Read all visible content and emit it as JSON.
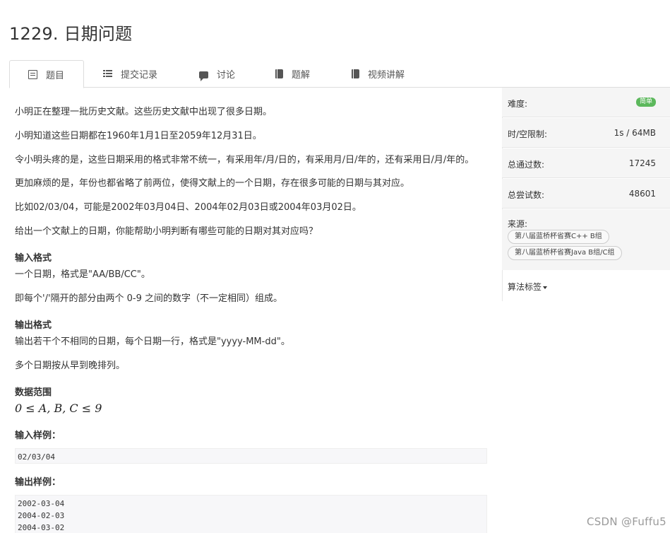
{
  "title": "1229. 日期问题",
  "tabs": [
    {
      "label": "题目",
      "icon": "document-icon"
    },
    {
      "label": "提交记录",
      "icon": "list-icon"
    },
    {
      "label": "讨论",
      "icon": "comment-icon"
    },
    {
      "label": "题解",
      "icon": "book-icon"
    },
    {
      "label": "视频讲解",
      "icon": "book-icon"
    }
  ],
  "problem": {
    "paragraphs": [
      "小明正在整理一批历史文献。这些历史文献中出现了很多日期。",
      "小明知道这些日期都在1960年1月1日至2059年12月31日。",
      "令小明头疼的是，这些日期采用的格式非常不统一，有采用年/月/日的，有采用月/日/年的，还有采用日/月/年的。",
      "更加麻烦的是，年份也都省略了前两位，使得文献上的一个日期，存在很多可能的日期与其对应。",
      "比如02/03/04，可能是2002年03月04日、2004年02月03日或2004年03月02日。",
      "给出一个文献上的日期，你能帮助小明判断有哪些可能的日期对其对应吗？"
    ],
    "input_heading": "输入格式",
    "input_lines": [
      "一个日期，格式是\"AA/BB/CC\"。",
      "即每个'/'隔开的部分由两个 0-9 之间的数字（不一定相同）组成。"
    ],
    "output_heading": "输出格式",
    "output_lines": [
      "输出若干个不相同的日期，每个日期一行，格式是\"yyyy-MM-dd\"。",
      "多个日期按从早到晚排列。"
    ],
    "range_heading": "数据范围",
    "range_formula": "0 ≤ A, B, C ≤ 9",
    "sample_input_heading": "输入样例：",
    "sample_input": "02/03/04",
    "sample_output_heading": "输出样例：",
    "sample_output": "2002-03-04\n2004-02-03\n2004-03-02"
  },
  "sidebar": {
    "difficulty_label": "难度:",
    "difficulty_value": "简单",
    "limit_label": "时/空限制:",
    "limit_value": "1s / 64MB",
    "passed_label": "总通过数:",
    "passed_value": "17245",
    "attempts_label": "总尝试数:",
    "attempts_value": "48601",
    "source_label": "来源:",
    "source_tags": [
      "第八届蓝桥杯省赛C++ B组",
      "第八届蓝桥杯省赛Java B组/C组"
    ],
    "algo_label": "算法标签"
  },
  "watermark": "CSDN @Fuffu5",
  "colors": {
    "badge": "#5cb85c",
    "code_bg": "#f7f7f9",
    "sidebar_bg": "#f5f5f5"
  }
}
